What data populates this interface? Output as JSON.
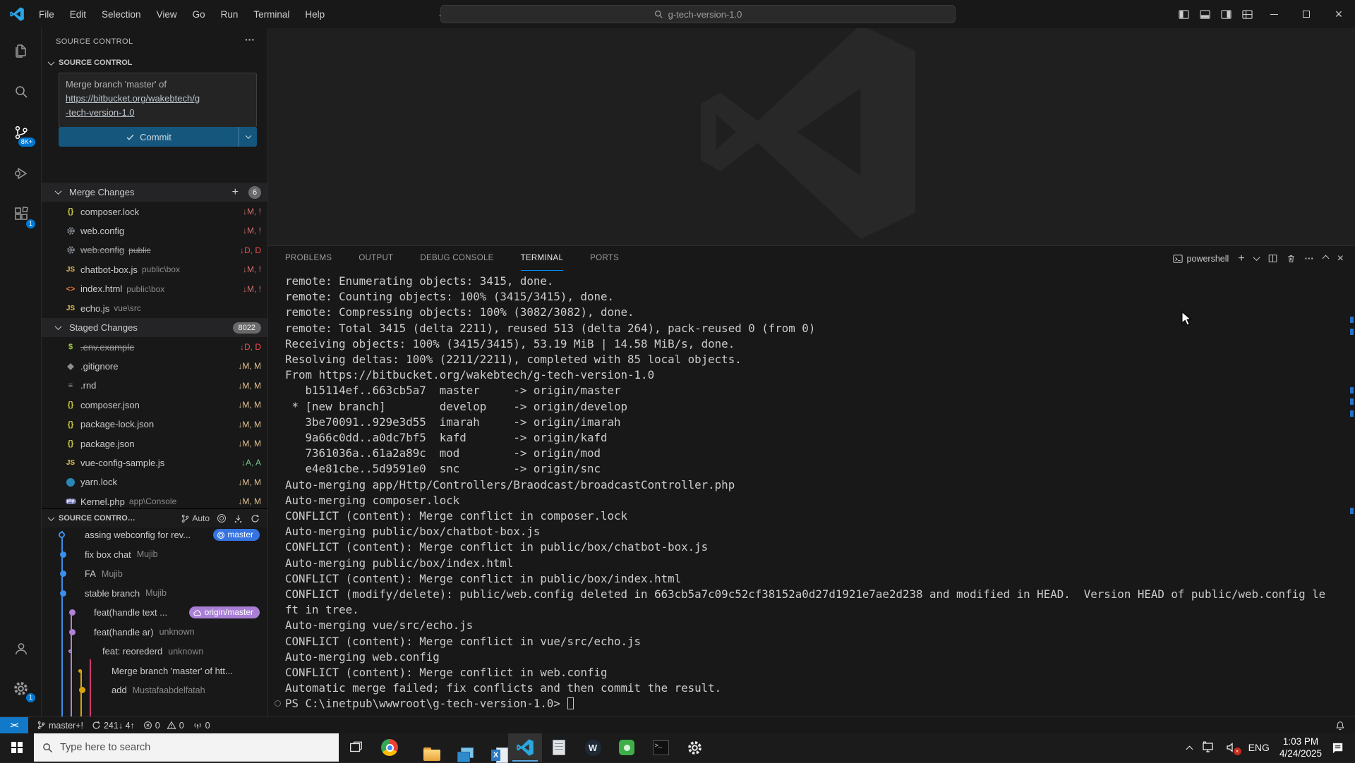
{
  "window": {
    "search_title": "g-tech-version-1.0"
  },
  "menus": [
    "File",
    "Edit",
    "Selection",
    "View",
    "Go",
    "Run",
    "Terminal",
    "Help"
  ],
  "activity_bar": {
    "scm_badge": "8K+",
    "extensions_badge": "1",
    "settings_badge": "1"
  },
  "scm": {
    "panel_title": "SOURCE CONTROL",
    "section_title": "SOURCE CONTROL",
    "commit_line1": "Merge branch 'master' of",
    "commit_link1": "https://bitbucket.org/wakebtech/g",
    "commit_link2": "-tech-version-1.0",
    "commit_button": "Commit",
    "merge": {
      "label": "Merge Changes",
      "badge": "6",
      "files": [
        {
          "icon": "braces",
          "name": "composer.lock",
          "desc": "",
          "badge": "↓M, !",
          "status": "conflict",
          "strike": false
        },
        {
          "icon": "gear",
          "name": "web.config",
          "desc": "",
          "badge": "↓M, !",
          "status": "conflict",
          "strike": false
        },
        {
          "icon": "gear",
          "name": "web.config",
          "desc": "public",
          "badge": "↓D, D",
          "status": "deleted",
          "strike": true
        },
        {
          "icon": "js",
          "name": "chatbot-box.js",
          "desc": "public\\box",
          "badge": "↓M, !",
          "status": "conflict",
          "strike": false
        },
        {
          "icon": "html",
          "name": "index.html",
          "desc": "public\\box",
          "badge": "↓M, !",
          "status": "conflict",
          "strike": false
        },
        {
          "icon": "js",
          "name": "echo.js",
          "desc": "vue\\src",
          "badge": "",
          "status": "conflict",
          "strike": false
        }
      ]
    },
    "staged": {
      "label": "Staged Changes",
      "badge": "8022",
      "files": [
        {
          "icon": "dollar",
          "name": ".env.example",
          "desc": "",
          "badge": "↓D, D",
          "status": "deleted",
          "strike": true
        },
        {
          "icon": "diamond",
          "name": ".gitignore",
          "desc": "",
          "badge": "↓M, M",
          "status": "modified",
          "strike": false
        },
        {
          "icon": "lines",
          "name": ".rnd",
          "desc": "",
          "badge": "↓M, M",
          "status": "modified",
          "strike": false
        },
        {
          "icon": "braces",
          "name": "composer.json",
          "desc": "",
          "badge": "↓M, M",
          "status": "modified",
          "strike": false
        },
        {
          "icon": "braces",
          "name": "package-lock.json",
          "desc": "",
          "badge": "↓M, M",
          "status": "modified",
          "strike": false
        },
        {
          "icon": "braces",
          "name": "package.json",
          "desc": "",
          "badge": "↓M, M",
          "status": "modified",
          "strike": false
        },
        {
          "icon": "js",
          "name": "vue-config-sample.js",
          "desc": "",
          "badge": "↓A, A",
          "status": "added",
          "strike": false
        },
        {
          "icon": "yarn",
          "name": "yarn.lock",
          "desc": "",
          "badge": "↓M, M",
          "status": "modified",
          "strike": false
        },
        {
          "icon": "php",
          "name": "Kernel.php",
          "desc": "app\\Console",
          "badge": "↓M, M",
          "status": "modified",
          "strike": false
        }
      ]
    },
    "graph": {
      "label": "SOURCE CONTROL ...",
      "auto_label": "Auto",
      "items": [
        {
          "label": "assing webconfig for rev...",
          "author": "",
          "color": "blue",
          "node": "open",
          "badge": "master",
          "badge_type": "local"
        },
        {
          "label": "fix box chat",
          "author": "Mujib",
          "color": "blue",
          "node": "filled",
          "badge": ""
        },
        {
          "label": "FA",
          "author": "Mujib",
          "color": "blue",
          "node": "filled",
          "badge": ""
        },
        {
          "label": "stable branch",
          "author": "Mujib",
          "color": "blue",
          "node": "filled",
          "badge": ""
        },
        {
          "label": "feat(handle text ...",
          "author": "",
          "color": "purple",
          "node": "filled",
          "badge": "origin/master",
          "badge_type": "remote"
        },
        {
          "label": "feat(handle ar)",
          "author": "unknown",
          "color": "purple",
          "node": "filled",
          "badge": ""
        },
        {
          "label": "feat: reorederd",
          "author": "unknown",
          "color": "purple",
          "node": "ring",
          "badge": ""
        },
        {
          "label": "Merge branch 'master' of htt...",
          "author": "",
          "color": "yellow",
          "node": "ring",
          "badge": ""
        },
        {
          "label": "add",
          "author": "Mustafaabdelfatah",
          "color": "yellow",
          "node": "filled",
          "badge": ""
        }
      ]
    }
  },
  "terminal": {
    "tabs": [
      "PROBLEMS",
      "OUTPUT",
      "DEBUG CONSOLE",
      "TERMINAL",
      "PORTS"
    ],
    "active_tab": "TERMINAL",
    "shell_label": "powershell",
    "lines": [
      "remote: Enumerating objects: 3415, done.",
      "remote: Counting objects: 100% (3415/3415), done.",
      "remote: Compressing objects: 100% (3082/3082), done.",
      "remote: Total 3415 (delta 2211), reused 513 (delta 264), pack-reused 0 (from 0)",
      "Receiving objects: 100% (3415/3415), 53.19 MiB | 14.58 MiB/s, done.",
      "Resolving deltas: 100% (2211/2211), completed with 85 local objects.",
      "From https://bitbucket.org/wakebtech/g-tech-version-1.0",
      "   b15114ef..663cb5a7  master     -> origin/master",
      " * [new branch]        develop    -> origin/develop",
      "   3be70091..929e3d55  imarah     -> origin/imarah",
      "   9a66c0dd..a0dc7bf5  kafd       -> origin/kafd",
      "   7361036a..61a2a89c  mod        -> origin/mod",
      "   e4e81cbe..5d9591e0  snc        -> origin/snc",
      "Auto-merging app/Http/Controllers/Braodcast/broadcastController.php",
      "Auto-merging composer.lock",
      "CONFLICT (content): Merge conflict in composer.lock",
      "Auto-merging public/box/chatbot-box.js",
      "CONFLICT (content): Merge conflict in public/box/chatbot-box.js",
      "Auto-merging public/box/index.html",
      "CONFLICT (content): Merge conflict in public/box/index.html",
      "CONFLICT (modify/delete): public/web.config deleted in 663cb5a7c09c52cf38152a0d27d1921e7ae2d238 and modified in HEAD.  Version HEAD of public/web.config le",
      "ft in tree.",
      "Auto-merging vue/src/echo.js",
      "CONFLICT (content): Merge conflict in vue/src/echo.js",
      "Auto-merging web.config",
      "CONFLICT (content): Merge conflict in web.config",
      "Automatic merge failed; fix conflicts and then commit the result.",
      "PS C:\\inetpub\\wwwroot\\g-tech-version-1.0> "
    ]
  },
  "status_bar": {
    "remote": "><",
    "branch": "master+!",
    "sync": "241↓ 4↑",
    "errors": "0",
    "warnings": "0",
    "broadcast": "0"
  },
  "taskbar": {
    "search_placeholder": "Type here to search",
    "lang": "ENG",
    "time": "1:03 PM",
    "date": "4/24/2025"
  }
}
